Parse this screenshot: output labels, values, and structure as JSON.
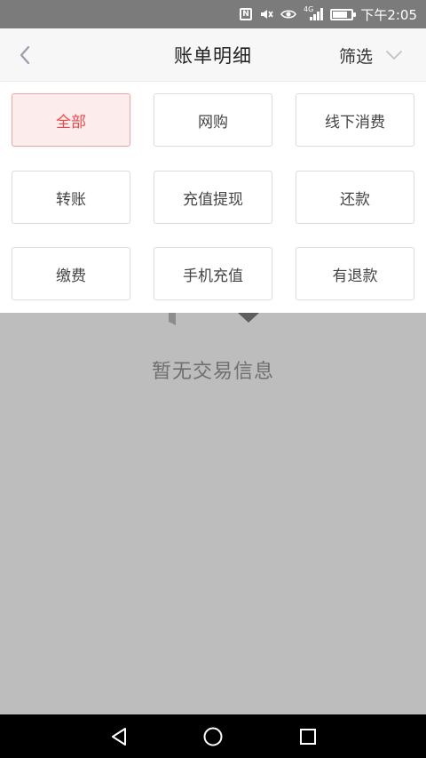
{
  "status_bar": {
    "network_tag": "4G",
    "time": "下午2:05"
  },
  "header": {
    "title": "账单明细",
    "filter_label": "筛选"
  },
  "filter_options": [
    {
      "label": "全部",
      "selected": true
    },
    {
      "label": "网购",
      "selected": false
    },
    {
      "label": "线下消费",
      "selected": false
    },
    {
      "label": "转账",
      "selected": false
    },
    {
      "label": "充值提现",
      "selected": false
    },
    {
      "label": "还款",
      "selected": false
    },
    {
      "label": "缴费",
      "selected": false
    },
    {
      "label": "手机充值",
      "selected": false
    },
    {
      "label": "有退款",
      "selected": false
    }
  ],
  "empty_state": {
    "message": "暂无交易信息"
  },
  "colors": {
    "accent": "#e8494a",
    "selected_bg": "#fdecec",
    "overlay": "#bdbdbd",
    "status_bar": "#7b7b7b"
  },
  "icons": {
    "back": "chevron-left-icon",
    "filter": "chevron-down-icon",
    "nav_back": "triangle-back-icon",
    "nav_home": "circle-home-icon",
    "nav_recent": "square-recent-icon"
  }
}
